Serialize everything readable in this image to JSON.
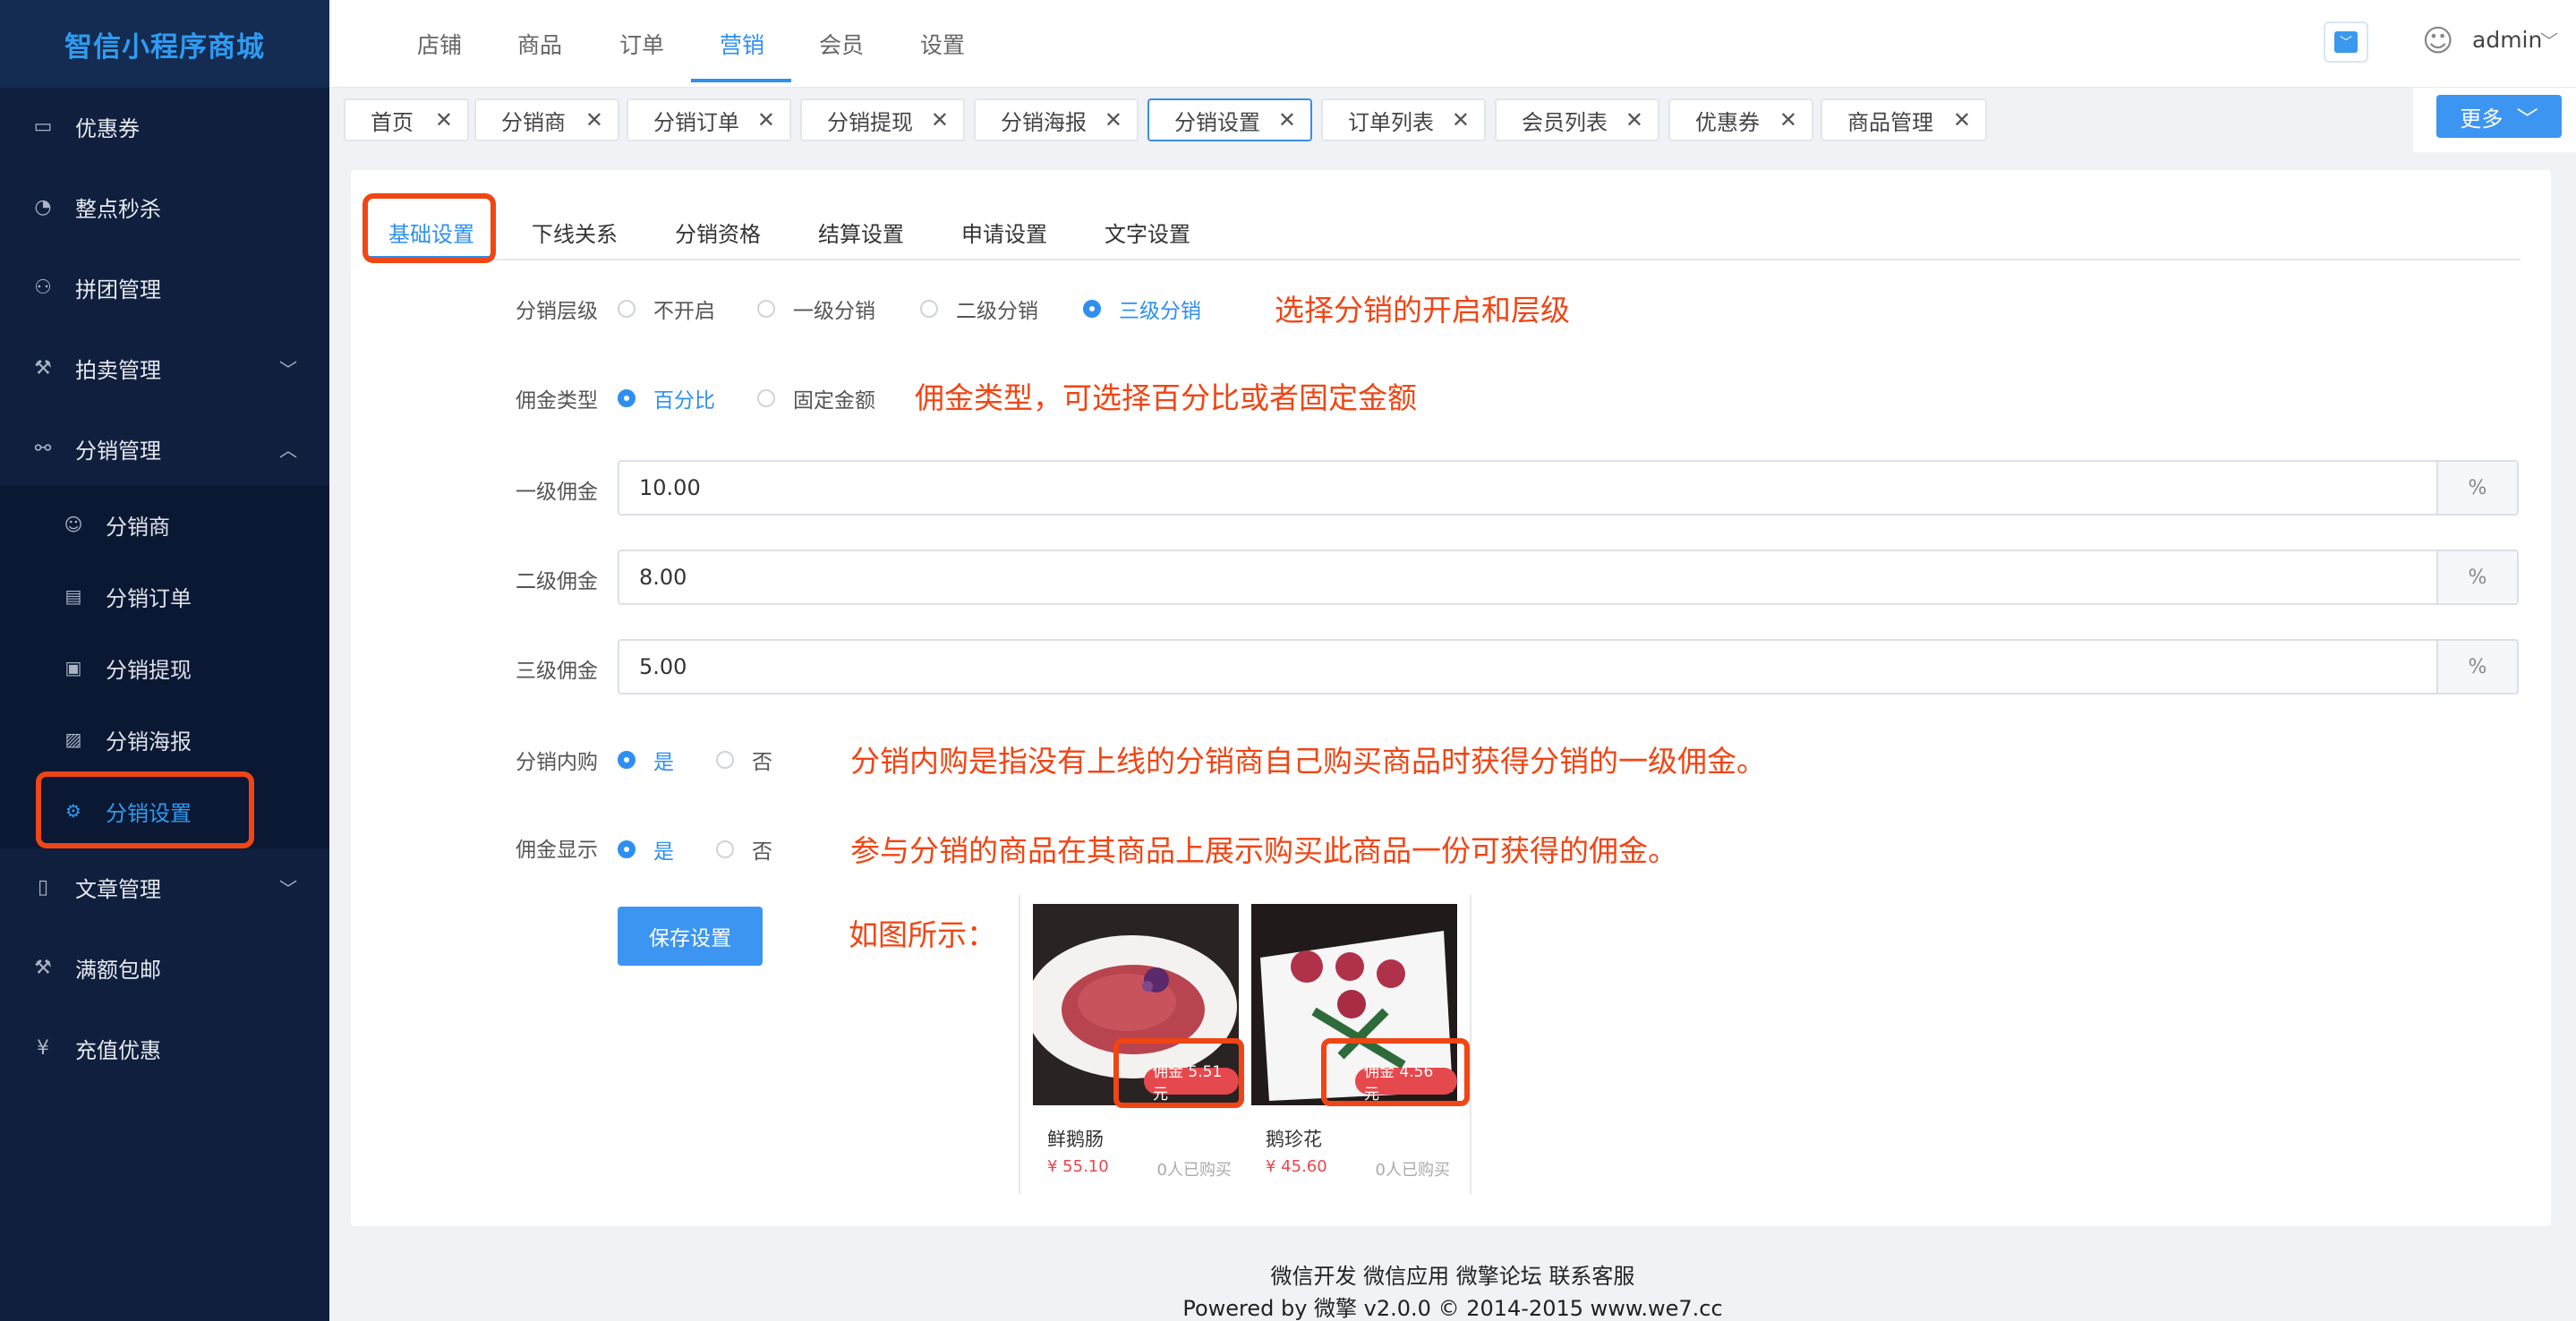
{
  "brand": "智信小程序商城",
  "sidebar": {
    "items": [
      {
        "label": "优惠券",
        "icon": "coupon-icon"
      },
      {
        "label": "整点秒杀",
        "icon": "flash-sale-icon"
      },
      {
        "label": "拼团管理",
        "icon": "group-icon"
      },
      {
        "label": "拍卖管理",
        "icon": "auction-icon"
      },
      {
        "label": "分销管理",
        "icon": "distribution-icon"
      },
      {
        "label": "文章管理",
        "icon": "article-icon"
      },
      {
        "label": "满额包邮",
        "icon": "shipping-icon"
      },
      {
        "label": "充值优惠",
        "icon": "recharge-icon"
      }
    ],
    "sub": [
      {
        "label": "分销商",
        "icon": "user-icon"
      },
      {
        "label": "分销订单",
        "icon": "order-icon"
      },
      {
        "label": "分销提现",
        "icon": "wallet-icon"
      },
      {
        "label": "分销海报",
        "icon": "image-icon"
      },
      {
        "label": "分销设置",
        "icon": "gear-icon"
      }
    ]
  },
  "topnav": {
    "items": [
      "店铺",
      "商品",
      "订单",
      "营销",
      "会员",
      "设置"
    ],
    "active": "营销",
    "user": "admin"
  },
  "tabs": [
    "首页",
    "分销商",
    "分销订单",
    "分销提现",
    "分销海报",
    "分销设置",
    "订单列表",
    "会员列表",
    "优惠券",
    "商品管理"
  ],
  "more_label": "更多",
  "subtabs": [
    "基础设置",
    "下线关系",
    "分销资格",
    "结算设置",
    "申请设置",
    "文字设置"
  ],
  "form": {
    "level": {
      "label": "分销层级",
      "options": [
        "不开启",
        "一级分销",
        "二级分销",
        "三级分销"
      ],
      "selected": "三级分销"
    },
    "commission_type": {
      "label": "佣金类型",
      "options": [
        "百分比",
        "固定金额"
      ],
      "selected": "百分比"
    },
    "level1": {
      "label": "一级佣金",
      "value": "10.00",
      "suffix": "%"
    },
    "level2": {
      "label": "二级佣金",
      "value": "8.00",
      "suffix": "%"
    },
    "level3": {
      "label": "三级佣金",
      "value": "5.00",
      "suffix": "%"
    },
    "self_buy": {
      "label": "分销内购",
      "options": [
        "是",
        "否"
      ],
      "selected": "是"
    },
    "show_commission": {
      "label": "佣金显示",
      "options": [
        "是",
        "否"
      ],
      "selected": "是"
    },
    "save_label": "保存设置"
  },
  "notes": {
    "level": "选择分销的开启和层级",
    "type": "佣金类型，可选择百分比或者固定金额",
    "self_buy": "分销内购是指没有上线的分销商自己购买商品时获得分销的一级佣金。",
    "show": "参与分销的商品在其商品上展示购买此商品一份可获得的佣金。",
    "example": "如图所示："
  },
  "products": [
    {
      "name": "鲜鹅肠",
      "price": "¥ 55.10",
      "sold": "0人已购买",
      "commission": "佣金 5.51元"
    },
    {
      "name": "鹅珍花",
      "price": "¥ 45.60",
      "sold": "0人已购买",
      "commission": "佣金 4.56元"
    }
  ],
  "footer": {
    "links": "微信开发 微信应用 微擎论坛 联系客服",
    "powered": "Powered by 微擎 v2.0.0 © 2014-2015 www.we7.cc"
  },
  "colors": {
    "accent": "#2e8ff0",
    "sidebar": "#0f1f3d",
    "annotation": "#f04514",
    "badge": "#e5484d"
  }
}
